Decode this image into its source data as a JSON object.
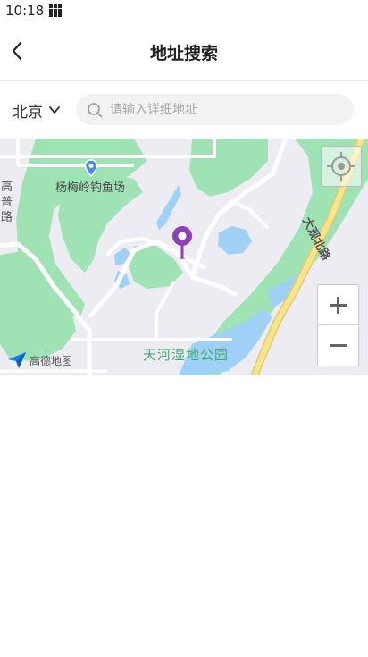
{
  "status_bar": {
    "time": "10:18"
  },
  "nav": {
    "title": "地址搜索"
  },
  "search": {
    "city": "北京",
    "placeholder": "请输入详细地址",
    "value": ""
  },
  "map": {
    "poi_label": "杨梅岭钓鱼场",
    "road_label_left": "高普路",
    "road_label_right": "大观北路",
    "park_label": "天河湿地公园",
    "logo_text": "高德地图",
    "zoom_in_label": "+",
    "zoom_out_label": "−"
  },
  "colors": {
    "map_background": "#ececf2",
    "green_area": "#9fe3b5",
    "water": "#9fd0f5",
    "road": "#ffffff",
    "highway": "#f7e58c",
    "pin": "#8e3fb8"
  }
}
